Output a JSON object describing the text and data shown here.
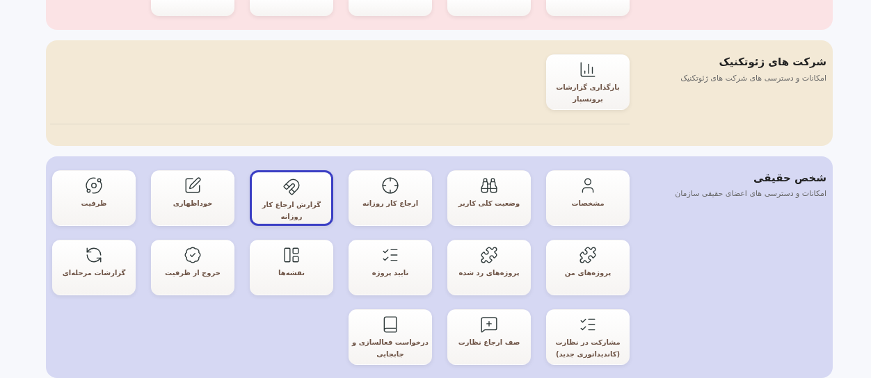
{
  "sections": [
    {
      "title": "شرکت های ژئوتکنیک",
      "subtitle": "امکانات و دسترسی های شرکت های ژئوتکنیک",
      "color": "#f3e9d6",
      "divider": true,
      "cards": [
        {
          "label": "بارگذاری گزارشات برونسپار",
          "selected": false
        }
      ]
    },
    {
      "title": "شخص حقیقی",
      "subtitle": "امکانات و دسترسی های اعضای حقیقی سازمان",
      "color": "#d6d8f3",
      "cards": [
        {
          "label": "مشخصات",
          "selected": false
        },
        {
          "label": "وضعیت کلی کاربر",
          "selected": false
        },
        {
          "label": "ارجاع کار روزانه",
          "selected": false
        },
        {
          "label": "گزارش ارجاع کار روزانه",
          "selected": true
        },
        {
          "label": "خوداظهاری",
          "selected": false
        },
        {
          "label": "ظرفیت",
          "selected": false
        },
        {
          "label": "پروژه‌های من",
          "selected": false
        },
        {
          "label": "پروژه‌های رد شده",
          "selected": false
        },
        {
          "label": "تایید پروژه",
          "selected": false
        },
        {
          "label": "نقشه‌ها",
          "selected": false
        },
        {
          "label": "خروج از ظرفیت",
          "selected": false
        },
        {
          "label": "گزارشات مرحله‌ای",
          "selected": false
        },
        {
          "label": "مشارکت در نظارت (کاندیداتوری جدید)",
          "selected": false
        },
        {
          "label": "صف ارجاع نظارت",
          "selected": false
        },
        {
          "label": "درخواست فعالسازی و جابجایی",
          "selected": false
        }
      ]
    }
  ]
}
